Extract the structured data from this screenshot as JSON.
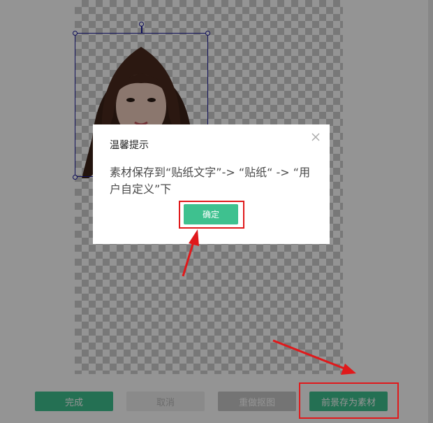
{
  "toolbar": {
    "done_label": "完成",
    "cancel_label": "取消",
    "redo_label": "重做抠图",
    "save_label": "前景存为素材"
  },
  "dialog": {
    "title": "温馨提示",
    "message": "素材保存到“贴纸文字”-> “贴纸“ -> “用户自定义”下",
    "confirm_label": "确定",
    "close_icon": "close-icon"
  },
  "colors": {
    "accent": "#3ec18f",
    "selection": "#1a1a9a",
    "annotation": "#e0191b"
  }
}
